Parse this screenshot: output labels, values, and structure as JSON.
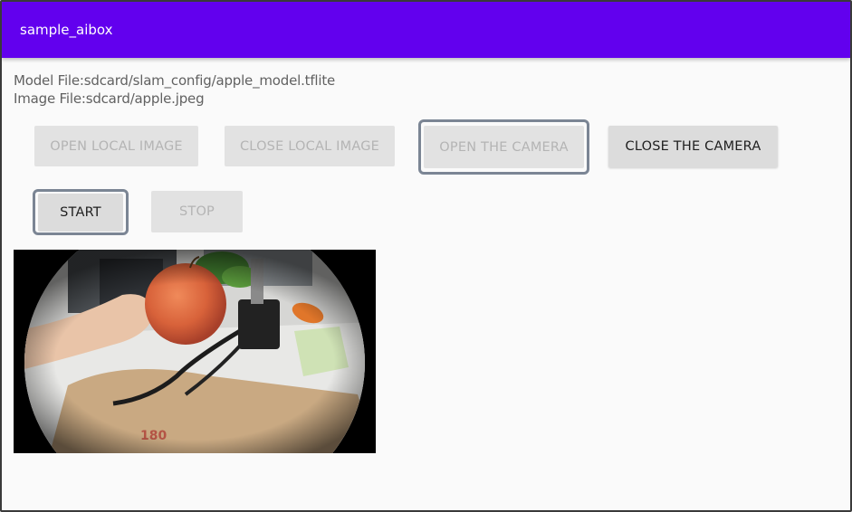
{
  "app_bar": {
    "title": "sample_aibox",
    "color": "#6200ee"
  },
  "info": {
    "model_file": "Model File:sdcard/slam_config/apple_model.tflite",
    "image_file": "Image File:sdcard/apple.jpeg"
  },
  "buttons": {
    "open_local_image": "OPEN LOCAL IMAGE",
    "close_local_image": "CLOSE LOCAL IMAGE",
    "open_camera": "OPEN THE CAMERA",
    "close_camera": "CLOSE THE CAMERA",
    "start": "START",
    "stop": "STOP"
  },
  "camera_view": {
    "content": "fisheye camera preview of an apple on a desk"
  }
}
